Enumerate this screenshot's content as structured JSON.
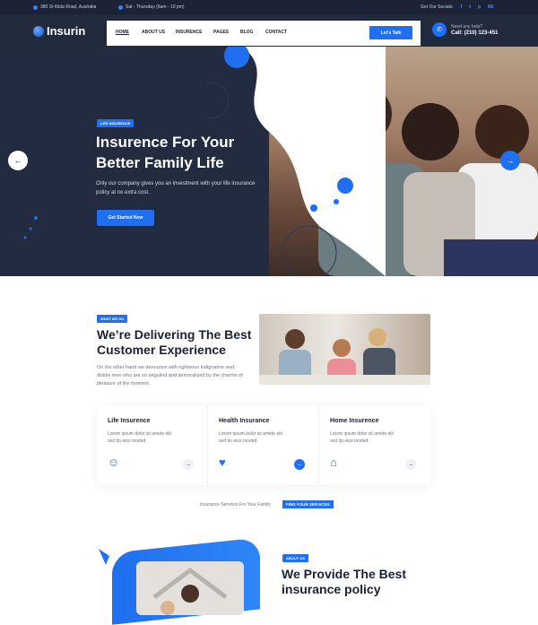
{
  "topbar": {
    "address": "380 St Kilda Road, Australia",
    "hours": "Sat - Thursday (9am - 10 pm)",
    "social_label": "Get Our Socials:",
    "social_icons": [
      "facebook-icon",
      "twitter-icon",
      "pinterest-icon",
      "behance-icon"
    ]
  },
  "header": {
    "logo": "Insurin",
    "nav": [
      "HOME",
      "ABOUT US",
      "INSURENCE",
      "PAGES",
      "BLOG",
      "CONTACT"
    ],
    "cta": "Let's Talk",
    "help_label": "Need any help?",
    "phone": "Call: (210) 123-451"
  },
  "hero": {
    "badge": "LIFE INSURENCE",
    "title_line1": "Insurence For Your",
    "title_line2": "Better Family Life",
    "description": "Only our company gives you an investment with your life insurance policy at no extra cost.",
    "button": "Get Started Now"
  },
  "about": {
    "badge": "WHAT WE DO",
    "title_line1": "We’re Delivering The Best",
    "title_line2": "Customer Experience",
    "description": "On the other hand we denounce with righteous indignation and dislike men who are so beguiled and demoralized by the charms of pleasure of the moment."
  },
  "cards": [
    {
      "title": "Life Insurence",
      "desc": "Lorem ipsum dolor sit amete elit sed do eius moded."
    },
    {
      "title": "Health Insurance",
      "desc": "Lorem ipsum dolor sit amete elit sed do eius moded."
    },
    {
      "title": "Home Insurence",
      "desc": "Lorem ipsum dolor sit amete elit sed do eius moded."
    }
  ],
  "services_strip": {
    "text": "Insurance Services For Your Family",
    "button": "FIND YOUR SERVICES"
  },
  "provide": {
    "badge": "ABOUT US",
    "title_line1": "We Provide The Best",
    "title_line2": "insurance policy"
  }
}
